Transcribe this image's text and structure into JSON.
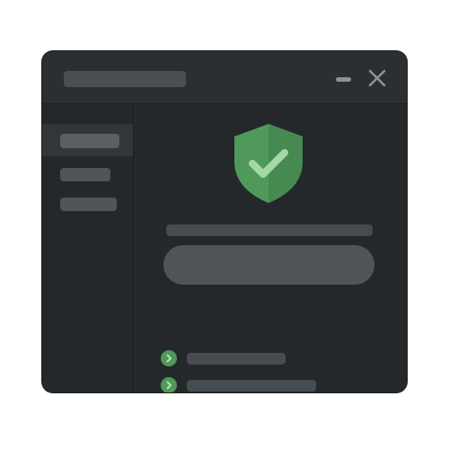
{
  "window": {
    "title": "",
    "controls": {
      "minimize_icon": "minimize-icon",
      "close_icon": "close-icon"
    }
  },
  "sidebar": {
    "items": [
      {
        "label": "",
        "active": true
      },
      {
        "label": "",
        "active": false
      },
      {
        "label": "",
        "active": false
      }
    ]
  },
  "main": {
    "status_icon": "shield-check-icon",
    "heading": "",
    "action_button_label": "",
    "checklist": [
      {
        "icon": "chevron-right-icon",
        "label": ""
      },
      {
        "icon": "chevron-right-icon",
        "label": ""
      },
      {
        "icon": "chevron-right-icon",
        "label": ""
      }
    ]
  },
  "colors": {
    "window_bg": "#25282b",
    "titlebar_bg": "#2b2f32",
    "accent_green": "#5fa866",
    "shield_fill": "#4f9a5a",
    "placeholder": "#4a4f52"
  }
}
